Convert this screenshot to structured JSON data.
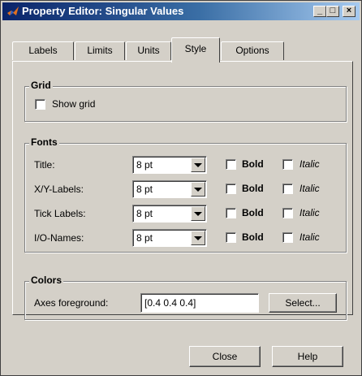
{
  "window": {
    "title": "Property Editor: Singular Values",
    "minimize_glyph": "_",
    "maximize_glyph": "□",
    "close_glyph": "×"
  },
  "tabs": [
    {
      "label": "Labels"
    },
    {
      "label": "Limits"
    },
    {
      "label": "Units"
    },
    {
      "label": "Style",
      "active": true
    },
    {
      "label": "Options"
    }
  ],
  "grid": {
    "title": "Grid",
    "show_grid_label": "Show grid",
    "show_grid_checked": false
  },
  "fonts": {
    "title": "Fonts",
    "bold_label": "Bold",
    "italic_label": "Italic",
    "rows": [
      {
        "label": "Title:",
        "size": "8 pt",
        "bold": false,
        "italic": false
      },
      {
        "label": "X/Y-Labels:",
        "size": "8 pt",
        "bold": false,
        "italic": false
      },
      {
        "label": "Tick Labels:",
        "size": "8 pt",
        "bold": false,
        "italic": false
      },
      {
        "label": "I/O-Names:",
        "size": "8 pt",
        "bold": false,
        "italic": false
      }
    ]
  },
  "colors": {
    "title": "Colors",
    "axes_foreground_label": "Axes foreground:",
    "axes_foreground_value": "[0.4 0.4 0.4]",
    "select_button": "Select..."
  },
  "footer": {
    "close_button": "Close",
    "help_button": "Help"
  },
  "palette": {
    "title_bar_start": "#0a246a",
    "title_bar_end": "#a6caf0",
    "dialog_face": "#d4d0c8"
  }
}
